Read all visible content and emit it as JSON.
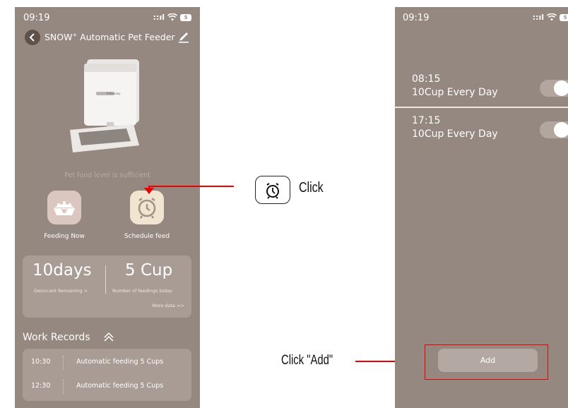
{
  "colors": {
    "phone_bg": "#958880",
    "card_bg": "#a89c95",
    "annotation_red": "#ee0000"
  },
  "left_screen": {
    "status": {
      "time": "09:19",
      "battery": "5"
    },
    "header": {
      "title_prefix": "SNOW",
      "title_mark": "+",
      "title_suffix": " Automatic Pet Feeder",
      "back_icon": "chevron-left-icon",
      "edit_icon": "pencil-icon"
    },
    "device_brand": "PetSnowy",
    "food_status": "Pet food level is sufficient",
    "actions": [
      {
        "label": "Feeding Now",
        "icon": "food-bowl-icon"
      },
      {
        "label": "Schedule feed",
        "icon": "alarm-clock-icon"
      }
    ],
    "stats": {
      "left_value": "10days",
      "left_label": "Desiccant Remaining >",
      "right_value": "5 Cup",
      "right_label": "Number of feedings today",
      "more": "More data >>"
    },
    "work_records": {
      "title": "Work Records",
      "items": [
        {
          "time": "10:30",
          "text": "Automatic feeding 5 Cups"
        },
        {
          "time": "12:30",
          "text": "Automatic feeding 5 Cups"
        }
      ]
    }
  },
  "annotations": {
    "click_label": "Click",
    "click_add_label": "Click \"Add\""
  },
  "right_screen": {
    "status": {
      "time": "09:19",
      "battery": "5"
    },
    "schedules": [
      {
        "time": "08:15",
        "desc": "10Cup Every Day",
        "enabled": true
      },
      {
        "time": "17:15",
        "desc": "10Cup Every Day",
        "enabled": true
      }
    ],
    "add_label": "Add"
  }
}
